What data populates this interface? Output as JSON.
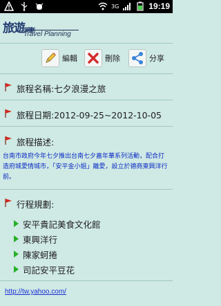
{
  "status_bar": {
    "time": "19:19",
    "network": "3G",
    "icons": [
      "alert-icon",
      "usb-icon",
      "debug-icon",
      "wifi-icon",
      "signal-icon",
      "battery-icon"
    ]
  },
  "header": {
    "logo_zh_big": "旅遊",
    "logo_zh_small": "規劃",
    "logo_en": "Travel Planning"
  },
  "toolbar": {
    "edit_label": "編輯",
    "delete_label": "刪除",
    "share_label": "分享"
  },
  "trip": {
    "name_row": "旅程名稱:七夕浪漫之旅",
    "date_row": "旅程日期:2012-09-25~2012-10-05",
    "desc_label": "旅程描述:",
    "desc_text": "台南市政府今年七夕推出台南七夕嘉年華系列活動，配合打造府城愛情城市，「安平金小姐」離愛，設立於德商東興洋行前。",
    "plan_label": "行程規劃:",
    "plan_items": [
      "安平貴記美食文化館",
      "東興洋行",
      "陳家蚵捲",
      "司記安平豆花"
    ]
  },
  "footer": {
    "link": "http://tw.yahoo.com/"
  },
  "colors": {
    "background": "#cfe9e4",
    "flag": "#d12b1f",
    "bullet": "#26b028",
    "desc": "#0b2cc4",
    "link": "#1a30d6"
  }
}
